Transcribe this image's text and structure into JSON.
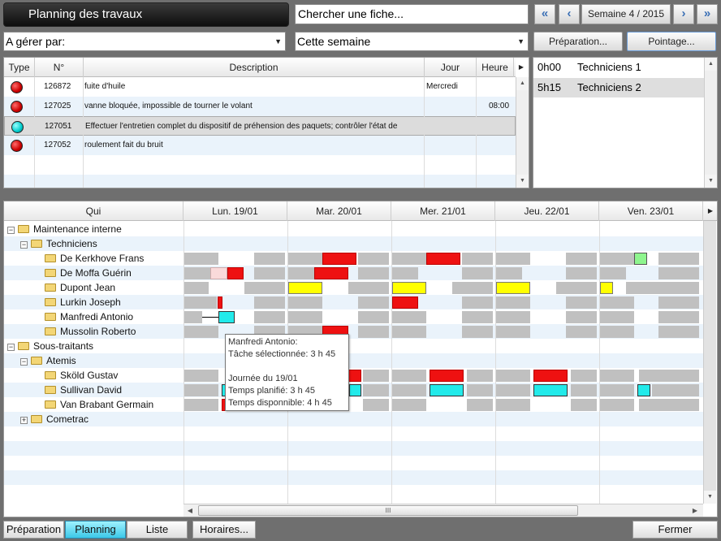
{
  "header": {
    "title": "Planning des travaux",
    "search_placeholder": "Chercher une fiche...",
    "week_label": "Semaine 4 / 2015",
    "first_icon": "«",
    "prev_icon": "‹",
    "next_icon": "›",
    "last_icon": "»"
  },
  "filters": {
    "manager_label": "A gérer par:",
    "period_label": "Cette semaine",
    "preparation_btn": "Préparation...",
    "pointage_btn": "Pointage..."
  },
  "tasks": {
    "columns": {
      "type": "Type",
      "number": "N°",
      "description": "Description",
      "day": "Jour",
      "hour": "Heure"
    },
    "rows": [
      {
        "number": "126872",
        "description": "fuite d'huile",
        "day": "Mercredi",
        "hour": ""
      },
      {
        "number": "127025",
        "description": "vanne bloquée, impossible de tourner le volant",
        "day": "",
        "hour": "08:00"
      },
      {
        "number": "127051",
        "description": "Effectuer l'entretien complet du dispositif de préhension des paquets; contrôler l'état de",
        "day": "",
        "hour": ""
      },
      {
        "number": "127052",
        "description": "roulement fait du bruit",
        "day": "",
        "hour": ""
      }
    ]
  },
  "techs": [
    {
      "hours": "0h00",
      "name": "Techniciens 1"
    },
    {
      "hours": "5h15",
      "name": "Techniciens 2"
    }
  ],
  "planning": {
    "qui_header": "Qui",
    "days": [
      "Lun. 19/01",
      "Mar. 20/01",
      "Mer. 21/01",
      "Jeu. 22/01",
      "Ven. 23/01"
    ],
    "tree": {
      "maintenance": "Maintenance interne",
      "techniciens": "Techniciens",
      "p1": "De Kerkhove Frans",
      "p2": "De Moffa Guérin",
      "p3": "Dupont Jean",
      "p4": "Lurkin Joseph",
      "p5": "Manfredi Antonio",
      "p6": "Mussolin Roberto",
      "sous": "Sous-traitants",
      "atemis": "Atemis",
      "p7": "Sköld Gustav",
      "p8": "Sullivan David",
      "p9": "Van Brabant Germain",
      "cometrac": "Cometrac"
    },
    "tooltip": {
      "l1": "Manfredi Antonio:",
      "l2": "Tâche sélectionnée: 3 h 45",
      "l3": "Journée du 19/01",
      "l4": "Temps planifié: 3 h 45",
      "l5": "Temps disponnible: 4 h 45"
    },
    "scroll_thumb": "III"
  },
  "bottom": {
    "tab_preparation": "Préparation",
    "tab_planning": "Planning",
    "tab_liste": "Liste",
    "horaires": "Horaires...",
    "fermer": "Fermer"
  }
}
